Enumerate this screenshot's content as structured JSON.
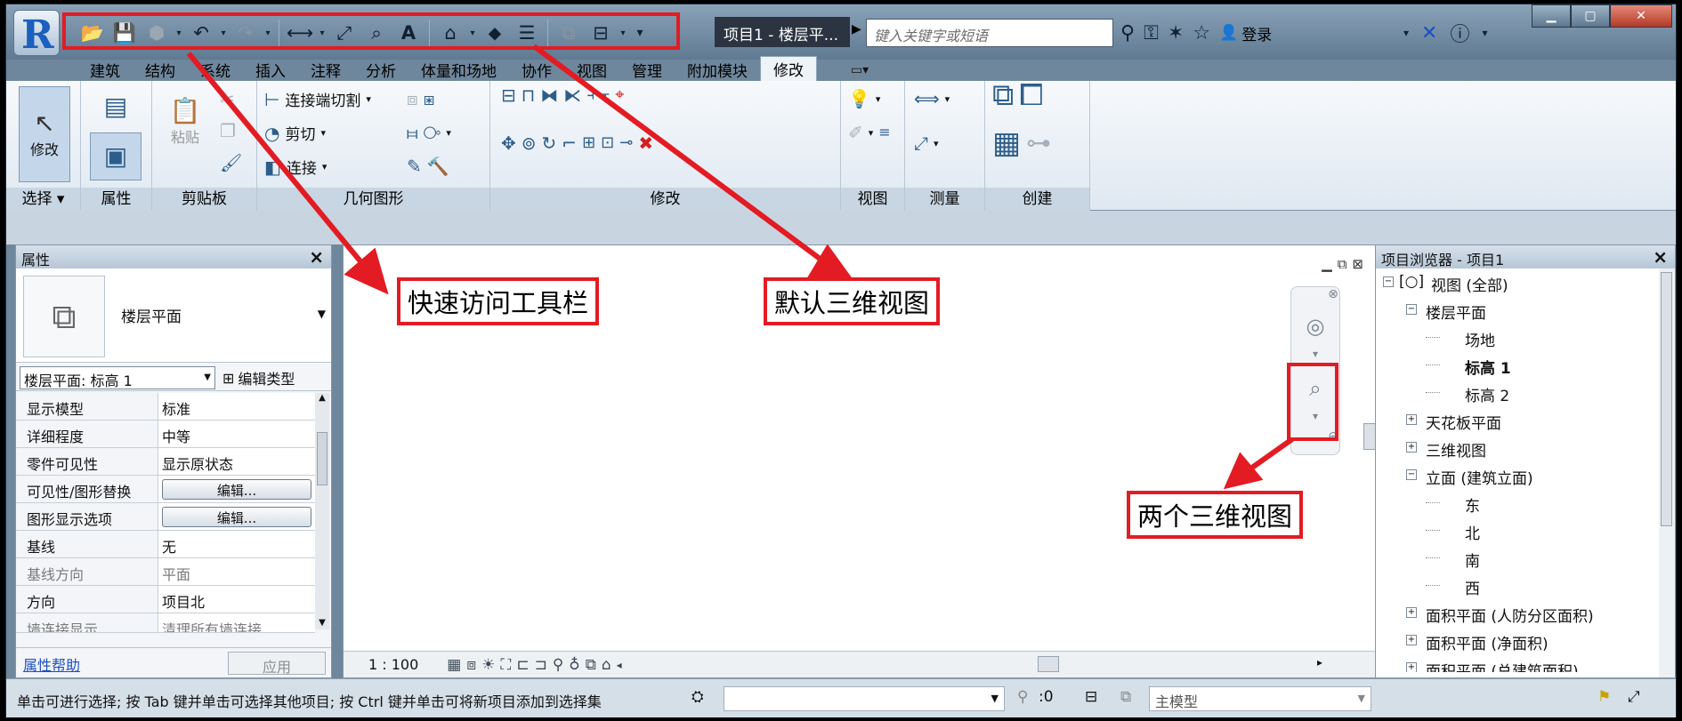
{
  "title_bar": {
    "app_logo": "R",
    "document_title": "项目1 - 楼层平...",
    "search_placeholder": "键入关键字或短语",
    "login_label": "登录",
    "qat_tools": [
      "open-icon",
      "save-icon",
      "sync-icon",
      "undo-icon",
      "redo-icon",
      "measure-icon",
      "dimension-icon",
      "tag-icon",
      "text-icon",
      "default-3d-view-icon",
      "section-icon",
      "thin-lines-icon",
      "close-hidden-icon",
      "switch-windows-icon"
    ],
    "qat_text_tool": "A"
  },
  "ribbon_tabs": [
    "建筑",
    "结构",
    "系统",
    "插入",
    "注释",
    "分析",
    "体量和场地",
    "协作",
    "视图",
    "管理",
    "附加模块",
    "修改"
  ],
  "active_tab": "修改",
  "ribbon": {
    "select_panel": {
      "title": "选择",
      "button": "修改"
    },
    "properties_panel": {
      "title": "属性"
    },
    "clipboard_panel": {
      "title": "剪贴板",
      "paste_label": "粘贴"
    },
    "geometry_panel": {
      "title": "几何图形",
      "cope_label": "连接端切割",
      "cut_label": "剪切",
      "join_label": "连接"
    },
    "modify_panel": {
      "title": "修改"
    },
    "view_panel": {
      "title": "视图"
    },
    "measure_panel": {
      "title": "测量"
    },
    "create_panel": {
      "title": "创建"
    }
  },
  "properties": {
    "header": "属性",
    "type_name": "楼层平面",
    "instance_selector": "楼层平面: 标高 1",
    "edit_type_label": "编辑类型",
    "rows": [
      {
        "key": "显示模型",
        "value": "标准"
      },
      {
        "key": "详细程度",
        "value": "中等"
      },
      {
        "key": "零件可见性",
        "value": "显示原状态"
      },
      {
        "key": "可见性/图形替换",
        "value": "编辑..."
      },
      {
        "key": "图形显示选项",
        "value": "编辑..."
      },
      {
        "key": "基线",
        "value": "无"
      },
      {
        "key": "基线方向",
        "value": "平面"
      },
      {
        "key": "方向",
        "value": "项目北"
      },
      {
        "key": "墙连接显示",
        "value": "清理所有墙连接"
      }
    ],
    "help_link": "属性帮助",
    "apply_label": "应用"
  },
  "canvas": {
    "scale": "1 : 100"
  },
  "project_browser": {
    "header": "项目浏览器 - 项目1",
    "nodes": [
      {
        "label": "视图 (全部)",
        "level": 0,
        "toggle": "-"
      },
      {
        "label": "楼层平面",
        "level": 1,
        "toggle": "-"
      },
      {
        "label": "场地",
        "level": 2,
        "toggle": ""
      },
      {
        "label": "标高 1",
        "level": 2,
        "toggle": "",
        "bold": true
      },
      {
        "label": "标高 2",
        "level": 2,
        "toggle": ""
      },
      {
        "label": "天花板平面",
        "level": 1,
        "toggle": "+"
      },
      {
        "label": "三维视图",
        "level": 1,
        "toggle": "+"
      },
      {
        "label": "立面 (建筑立面)",
        "level": 1,
        "toggle": "-"
      },
      {
        "label": "东",
        "level": 2,
        "toggle": ""
      },
      {
        "label": "北",
        "level": 2,
        "toggle": ""
      },
      {
        "label": "南",
        "level": 2,
        "toggle": ""
      },
      {
        "label": "西",
        "level": 2,
        "toggle": ""
      },
      {
        "label": "面积平面 (人防分区面积)",
        "level": 1,
        "toggle": "+"
      },
      {
        "label": "面积平面 (净面积)",
        "level": 1,
        "toggle": "+"
      },
      {
        "label": "面积平面 (总建筑面积)",
        "level": 1,
        "toggle": "+"
      }
    ]
  },
  "status_bar": {
    "message": "单击可进行选择; 按 Tab 键并单击可选择其他项目; 按 Ctrl 键并单击可将新项目添加到选择集",
    "selection_count": ":0",
    "model_label": "主模型"
  },
  "annotations": {
    "qat": "快速访问工具栏",
    "default_3d": "默认三维视图",
    "two_3d": "两个三维视图"
  },
  "colors": {
    "annotation_red": "#e31b23",
    "ribbon_blue": "#2d5d8a"
  }
}
